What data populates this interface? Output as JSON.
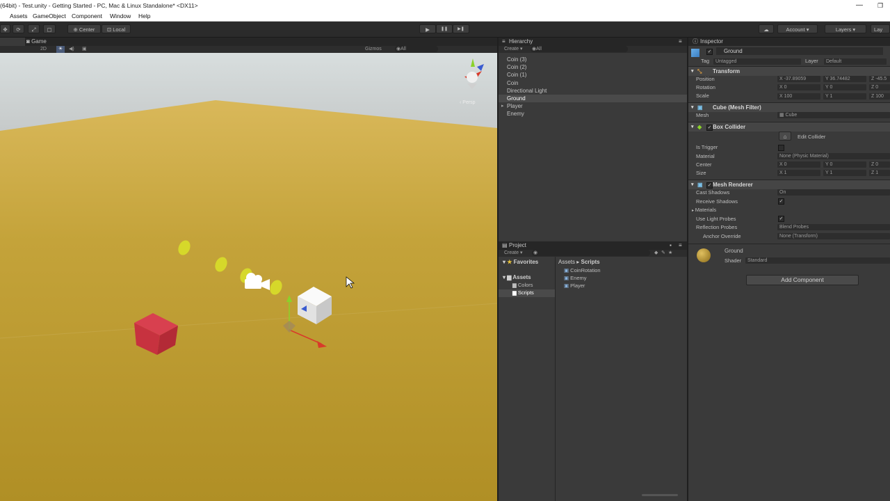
{
  "window": {
    "title": "(64bit) - Test.unity - Getting Started - PC, Mac & Linux Standalone* <DX11>",
    "minimize": "—",
    "maximize": "❐"
  },
  "menu": [
    "Assets",
    "GameObject",
    "Component",
    "Window",
    "Help"
  ],
  "toolbar": {
    "pivot": "Center",
    "space": "Local",
    "play": "▶",
    "pause": "❚❚",
    "step": "▶❚",
    "cloud": "☁",
    "account": "Account",
    "layers": "Layers",
    "layout": "Lay"
  },
  "scene": {
    "tab_game": "Game",
    "mode_2d": "2D",
    "gizmos": "Gizmos",
    "search_all": "◉All",
    "persp": "‹ Persp"
  },
  "hierarchy": {
    "title": "Hierarchy",
    "create": "Create",
    "search": "◉All",
    "items": [
      "Coin (3)",
      "Coin (2)",
      "Coin (1)",
      "Coin",
      "Directional Light",
      "Ground",
      "Player",
      "Enemy"
    ],
    "selected_index": 5
  },
  "project": {
    "title": "Project",
    "create": "Create",
    "favorites": "Favorites",
    "assets": "Assets",
    "folders": [
      "Colors",
      "Scripts"
    ],
    "breadcrumb_root": "Assets",
    "breadcrumb_sep": "▸",
    "breadcrumb_leaf": "Scripts",
    "scripts": [
      "CoinRotation",
      "Enemy",
      "Player"
    ]
  },
  "inspector": {
    "title": "Inspector",
    "object_name": "Ground",
    "tag_label": "Tag",
    "tag_value": "Untagged",
    "layer_label": "Layer",
    "layer_value": "Default",
    "transform": {
      "title": "Transform",
      "position_label": "Position",
      "rotation_label": "Rotation",
      "scale_label": "Scale",
      "position": [
        "X -37.89059",
        "Y 36.74482",
        "Z -45.5"
      ],
      "rotation": [
        "X 0",
        "Y 0",
        "Z 0"
      ],
      "scale": [
        "X 100",
        "Y 1",
        "Z 100"
      ]
    },
    "mesh_filter": {
      "title": "Cube (Mesh Filter)",
      "mesh_label": "Mesh",
      "mesh_value": "▦ Cube"
    },
    "box_collider": {
      "title": "Box Collider",
      "edit_label": "Edit Collider",
      "is_trigger_label": "Is Trigger",
      "material_label": "Material",
      "material_value": "None (Physic Material)",
      "center_label": "Center",
      "size_label": "Size",
      "center": [
        "X 0",
        "Y 0",
        "Z 0"
      ],
      "size": [
        "X 1",
        "Y 1",
        "Z 1"
      ]
    },
    "mesh_renderer": {
      "title": "Mesh Renderer",
      "cast_shadows_label": "Cast Shadows",
      "cast_shadows_value": "On",
      "receive_shadows_label": "Receive Shadows",
      "materials_label": "Materials",
      "light_probes_label": "Use Light Probes",
      "reflection_probes_label": "Reflection Probes",
      "reflection_probes_value": "Blend Probes",
      "anchor_label": "Anchor Override",
      "anchor_value": "None (Transform)"
    },
    "material": {
      "name": "Ground",
      "shader_label": "Shader",
      "shader_value": "Standard"
    },
    "add_component": "Add Component"
  },
  "colors": {
    "ground": "#b89a35",
    "sky": "#9b9b9b",
    "enemy": "#d23a4a",
    "coin": "#d4d22a"
  }
}
